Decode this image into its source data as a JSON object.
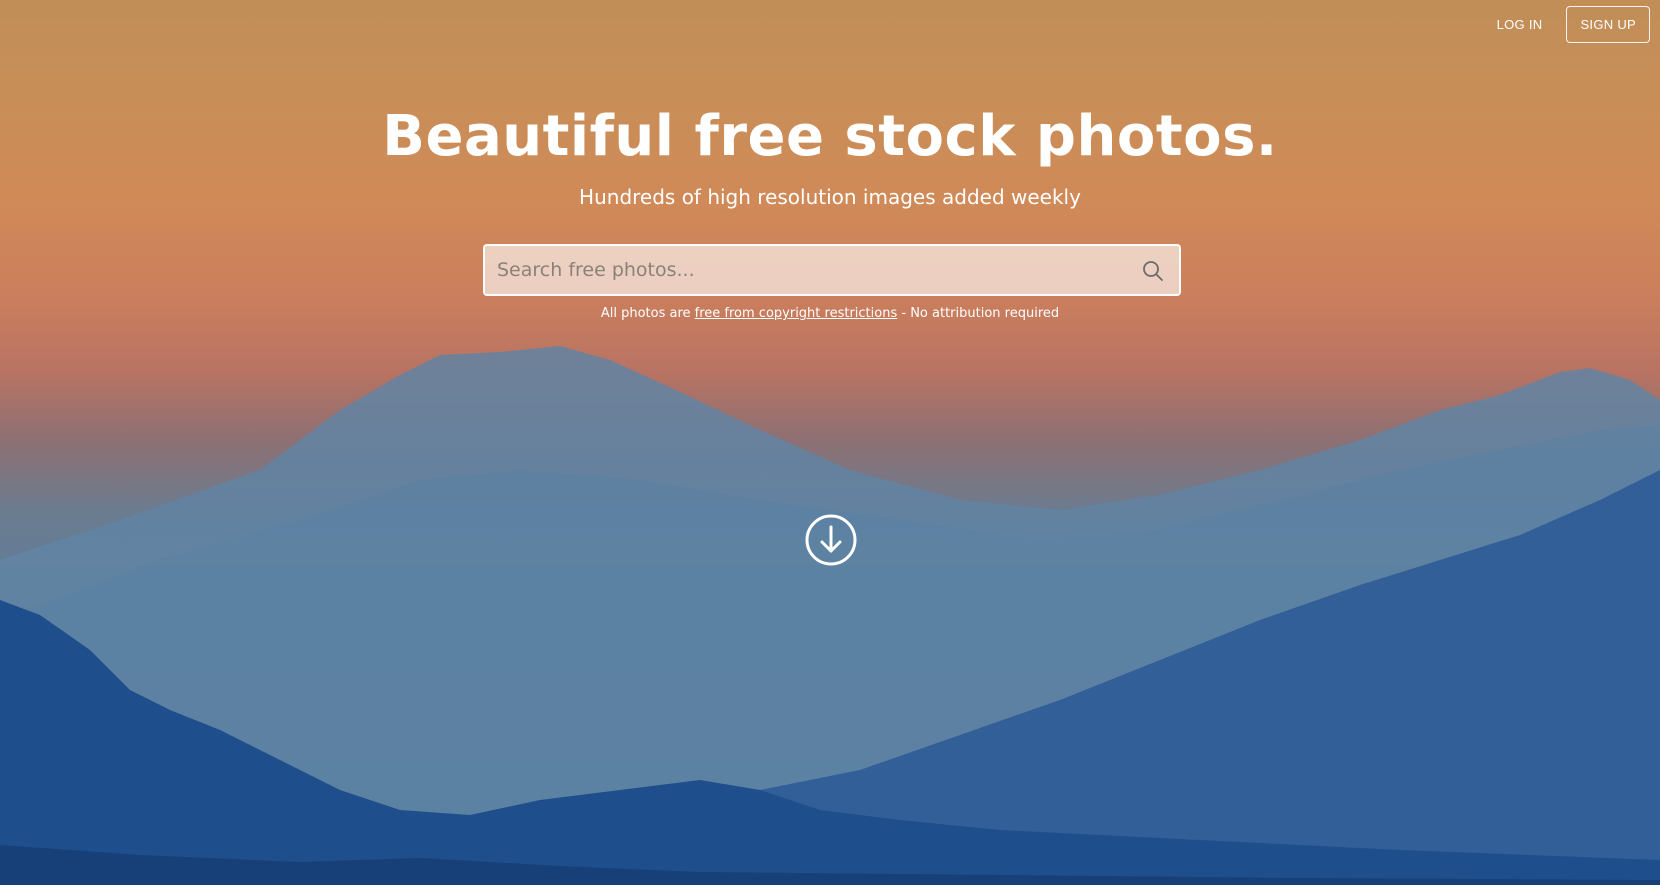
{
  "nav": {
    "login_label": "LOG IN",
    "signup_label": "SIGN UP"
  },
  "hero": {
    "headline": "Beautiful free stock photos.",
    "subheadline": "Hundreds of high resolution images added weekly"
  },
  "search": {
    "placeholder": "Search free photos...",
    "value": "",
    "icon": "search-icon"
  },
  "notice": {
    "prefix": "All photos are ",
    "link_text": "free from copyright restrictions",
    "suffix": " - No attribution required"
  },
  "scroll": {
    "icon": "arrow-down-circle-icon"
  },
  "colors": {
    "sky_top": "#c18e58",
    "sky_mid": "#cc7f5c",
    "mountain_far": "#5f88a8",
    "mountain_mid": "#3f6b9c",
    "mountain_near": "#1f4a86",
    "text": "#ffffff"
  }
}
